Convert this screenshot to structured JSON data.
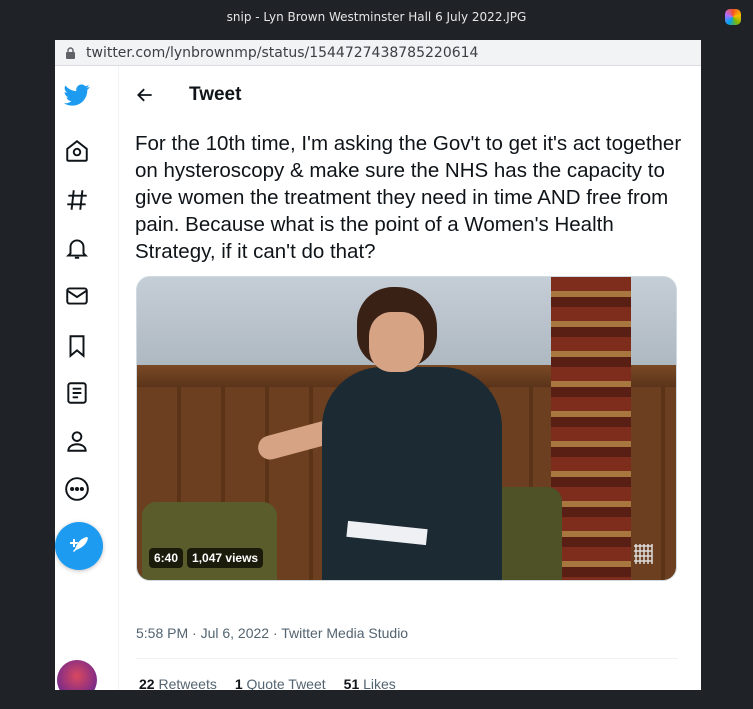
{
  "window": {
    "title": "snip - Lyn Brown Westminster Hall 6 July 2022.JPG"
  },
  "browser": {
    "url": "twitter.com/lynbrownmp/status/1544727438785220614"
  },
  "sidebar": {
    "items": [
      {
        "icon": "twitter-logo-icon"
      },
      {
        "icon": "home-icon"
      },
      {
        "icon": "explore-hashtag-icon"
      },
      {
        "icon": "notifications-bell-icon"
      },
      {
        "icon": "messages-envelope-icon"
      },
      {
        "icon": "bookmark-icon"
      },
      {
        "icon": "lists-icon"
      },
      {
        "icon": "profile-icon"
      },
      {
        "icon": "more-icon"
      }
    ],
    "compose_icon": "compose-tweet-icon"
  },
  "header": {
    "title": "Tweet"
  },
  "tweet": {
    "text": "For the 10th time, I'm asking the Gov't to get it's act together on hysteroscopy & make sure the NHS has the capacity to give women the treatment they need in time AND free from pain. Because what is the point of a Women's Health Strategy, if it can't do that?",
    "video": {
      "duration": "6:40",
      "views": "1,047 views"
    },
    "meta": "5:58 PM · Jul 6, 2022 · Twitter Media Studio",
    "stats": {
      "retweets_count": "22",
      "retweets_label": "Retweets",
      "quotes_count": "1",
      "quotes_label": "Quote Tweet",
      "likes_count": "51",
      "likes_label": "Likes"
    }
  },
  "colors": {
    "accent": "#1d9bf0",
    "text": "#0f1419",
    "secondary": "#536471"
  }
}
